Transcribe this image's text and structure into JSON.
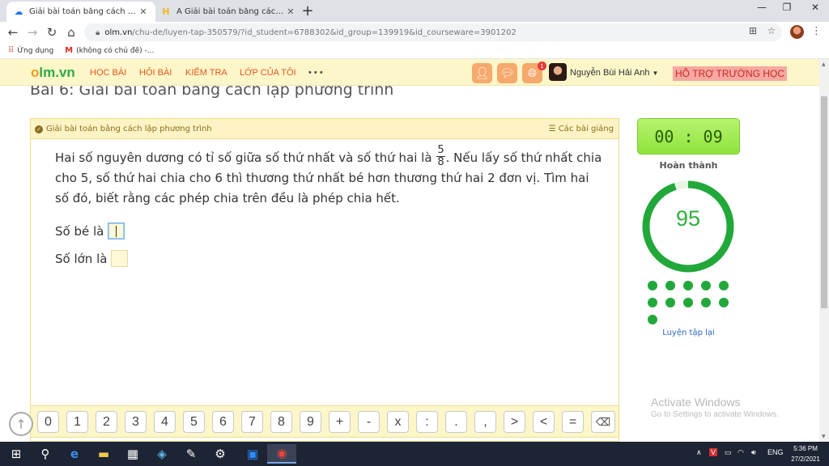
{
  "browser": {
    "tabs": [
      {
        "title": "Giải bài toán bằng cách lập phươ",
        "active": true,
        "favicon": "cloud-icon"
      },
      {
        "title": "A Giải bài toán bằng cách lập ph",
        "active": false,
        "favicon": "hoc24-icon"
      }
    ],
    "new_tab": "+",
    "url_host": "olm.vn",
    "url_path": "/chu-de/luyen-tap-350579/?id_student=6788302&id_group=139919&id_courseware=3901202",
    "bookmarks": [
      {
        "label": "Ứng dụng",
        "icon": "apps-grid-icon"
      },
      {
        "label": "(không có chủ đề) -...",
        "icon": "gmail-icon"
      }
    ]
  },
  "header": {
    "logo_part1": "o",
    "logo_part2": "lm.vn",
    "menu": [
      "HỌC BÀI",
      "HỎI BÀI",
      "KIỂM TRA",
      "LỚP CỦA TÔI",
      "• • •"
    ],
    "notification_count": "1",
    "username": "Nguyễn Bùi Hải Anh",
    "support": "HỖ TRỢ TRƯỜNG HỌC"
  },
  "lesson_title": "Bài 6: Giải bài toán bằng cách lập phương trình",
  "panel": {
    "head_left": "Giải bài toán bằng cách lập phương trình",
    "head_right": "Các bài giảng",
    "question_part1": "Hai số nguyên dương có tỉ số giữa số thứ nhất và số thứ hai là",
    "fraction_num": "5",
    "fraction_den": "8",
    "question_part2": ". Nếu lấy số thứ nhất chia cho 5, số thứ hai chia cho 6 thì thương thứ nhất bé hơn thương thứ hai 2 đơn vị. Tìm hai số đó, biết rằng các phép chia trên đều là phép chia hết.",
    "answer1_label": "Số bé là",
    "answer2_label": "Số lớn là"
  },
  "keypad": [
    "0",
    "1",
    "2",
    "3",
    "4",
    "5",
    "6",
    "7",
    "8",
    "9",
    "+",
    "-",
    "x",
    ":",
    ".",
    ",",
    ">",
    "<",
    "="
  ],
  "side": {
    "timer": "00 : 09",
    "status": "Hoàn thành",
    "score": "95",
    "score_progress": 0.95,
    "dots_count": 11,
    "retry": "Luyện tập lại"
  },
  "watermark": {
    "line1": "Activate Windows",
    "line2": "Go to Settings to activate Windows."
  },
  "taskbar": {
    "lang": "ENG",
    "time": "5:36 PM",
    "date": "27/2/2021"
  },
  "colors": {
    "brand_green": "#2ea84b",
    "brand_orange": "#e8551f",
    "score_green": "#22a83a"
  }
}
